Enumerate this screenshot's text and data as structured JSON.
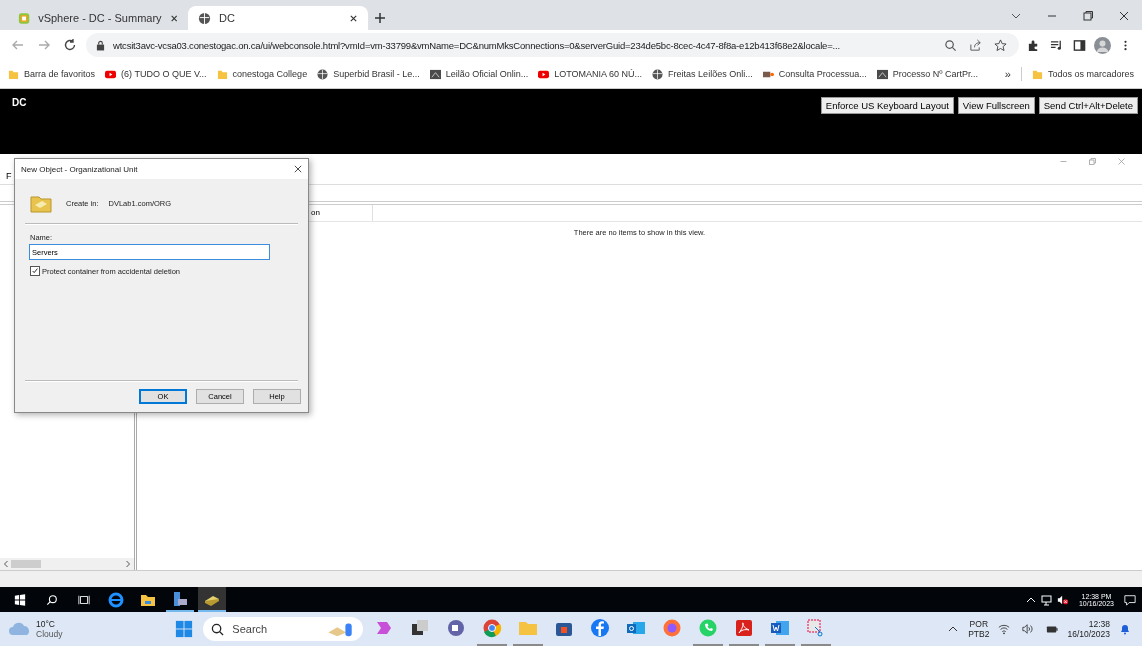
{
  "browser": {
    "tabs": [
      {
        "title": "vSphere - DC - Summary",
        "kind": "vsphere",
        "selected": false
      },
      {
        "title": "DC",
        "kind": "globe",
        "selected": true
      }
    ],
    "address": "wtcsit3avc-vcsa03.conestogac.on.ca/ui/webconsole.html?vmId=vm-33799&vmName=DC&numMksConnections=0&serverGuid=234de5bc-8cec-4c47-8f8a-e12b413f68e2&locale=...",
    "bookmarks": [
      {
        "label": "Barra de favoritos",
        "kind": "folder"
      },
      {
        "label": "(6) TUDO O QUE V...",
        "kind": "youtube"
      },
      {
        "label": "conestoga College",
        "kind": "folder"
      },
      {
        "label": "Superbid Brasil - Le...",
        "kind": "globe"
      },
      {
        "label": "Leilão Oficial Onlin...",
        "kind": "site"
      },
      {
        "label": "LOTOMANIA 60 NÚ...",
        "kind": "youtube"
      },
      {
        "label": "Freitas Leilões Onli...",
        "kind": "globe"
      },
      {
        "label": "Consulta Processua...",
        "kind": "pje"
      },
      {
        "label": "Processo Nº CartPr...",
        "kind": "site"
      }
    ],
    "bookmarks_more": "»",
    "all_bookmarks": "Todos os marcadores"
  },
  "console": {
    "vm_name": "DC",
    "buttons": [
      "Enforce US Keyboard Layout",
      "View Fullscreen",
      "Send Ctrl+Alt+Delete"
    ]
  },
  "aduc": {
    "menu_partial": "F",
    "column_partial": "on",
    "empty_message": "There are no items to show in this view."
  },
  "dialog": {
    "title": "New Object - Organizational Unit",
    "create_in_label": "Create in:",
    "create_in_path": "DVLab1.com/ORG",
    "name_label": "Name:",
    "name_value": "Servers",
    "protect": {
      "label": "Protect container from accidental deletion",
      "checked": true
    },
    "buttons": [
      {
        "label": "OK",
        "selected": true
      },
      {
        "label": "Cancel",
        "selected": false
      },
      {
        "label": "Help",
        "selected": false
      }
    ]
  },
  "vm_taskbar": {
    "apps": [
      {
        "kind": "ie",
        "running": false
      },
      {
        "kind": "folder",
        "running": false
      },
      {
        "kind": "server",
        "running": true
      },
      {
        "kind": "aduc",
        "running": true,
        "selected": true
      }
    ],
    "time": "12:38 PM",
    "date": "10/16/2023"
  },
  "host_taskbar": {
    "weather": {
      "temp": "10°C",
      "condition": "Cloudy"
    },
    "search_placeholder": "Search",
    "apps": [
      {
        "kind": "copilot",
        "running": false
      },
      {
        "kind": "taskview",
        "running": false
      },
      {
        "kind": "teams",
        "running": false
      },
      {
        "kind": "chrome",
        "running": true
      },
      {
        "kind": "folder",
        "running": true
      },
      {
        "kind": "store",
        "running": false
      },
      {
        "kind": "facebook",
        "running": false
      },
      {
        "kind": "outlook",
        "running": false
      },
      {
        "kind": "firefox",
        "running": false
      },
      {
        "kind": "whatsapp",
        "running": true
      },
      {
        "kind": "acrobat",
        "running": true
      },
      {
        "kind": "word",
        "running": true
      },
      {
        "kind": "snip",
        "running": true
      }
    ],
    "language": "POR",
    "layout": "PTB2",
    "time": "12:38",
    "date": "16/10/2023"
  }
}
